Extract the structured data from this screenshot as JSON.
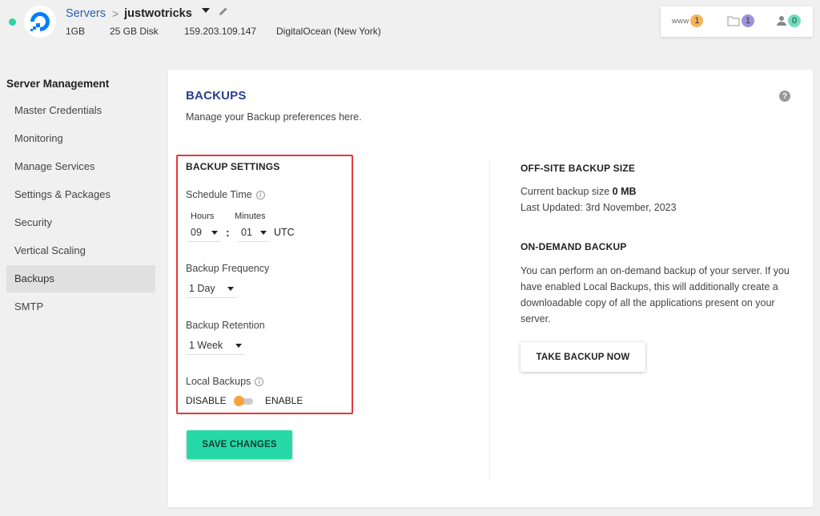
{
  "header": {
    "breadcrumb_root": "Servers",
    "breadcrumb_sep": ">",
    "server_name": "justwotricks",
    "specs": {
      "ram": "1GB",
      "disk": "25 GB Disk",
      "ip": "159.203.109.147",
      "provider": "DigitalOcean (New York)"
    },
    "badges": {
      "www_label": "www",
      "www_count": "1",
      "apps_count": "1",
      "users_count": "0"
    }
  },
  "sidebar": {
    "title": "Server Management",
    "items": [
      {
        "label": "Master Credentials"
      },
      {
        "label": "Monitoring"
      },
      {
        "label": "Manage Services"
      },
      {
        "label": "Settings & Packages"
      },
      {
        "label": "Security"
      },
      {
        "label": "Vertical Scaling"
      },
      {
        "label": "Backups"
      },
      {
        "label": "SMTP"
      }
    ]
  },
  "main": {
    "title": "BACKUPS",
    "subtitle": "Manage your Backup preferences here.",
    "help_glyph": "?",
    "settings": {
      "title": "BACKUP SETTINGS",
      "schedule_label": "Schedule Time",
      "hours_label": "Hours",
      "minutes_label": "Minutes",
      "hours_value": "09",
      "minutes_value": "01",
      "colon": ":",
      "tz": "UTC",
      "frequency_label": "Backup Frequency",
      "frequency_value": "1 Day",
      "retention_label": "Backup Retention",
      "retention_value": "1 Week",
      "local_label": "Local Backups",
      "disable_label": "DISABLE",
      "enable_label": "ENABLE",
      "save_label": "SAVE CHANGES"
    },
    "offsite": {
      "title": "OFF-SITE BACKUP SIZE",
      "size_prefix": "Current backup size",
      "size_value": "0 MB",
      "updated": "Last Updated: 3rd November, 2023"
    },
    "ondemand": {
      "title": "ON-DEMAND BACKUP",
      "desc_lines": [
        "You can perform an on-demand backup of your server. If you",
        "have enabled Local Backups, this will additionally create a",
        "downloadable copy of all the applications present on your",
        "server."
      ],
      "button_label": "TAKE BACKUP NOW"
    }
  },
  "colors": {
    "accent_green": "#27d9a9",
    "title_blue": "#2c3e8f",
    "link_blue": "#2a5fb4",
    "highlight_red": "#e03a3a",
    "toggle_orange": "#f5a33b",
    "badge_www": "#f5b45c",
    "badge_apps": "#9b93dd",
    "badge_users": "#6ee0bc"
  },
  "icons": {
    "logo": "digitalocean-logo",
    "edit": "pencil-icon",
    "apps": "folder-icon",
    "users": "user-icon",
    "help": "question-circle-icon",
    "info": "info-circle-icon"
  }
}
